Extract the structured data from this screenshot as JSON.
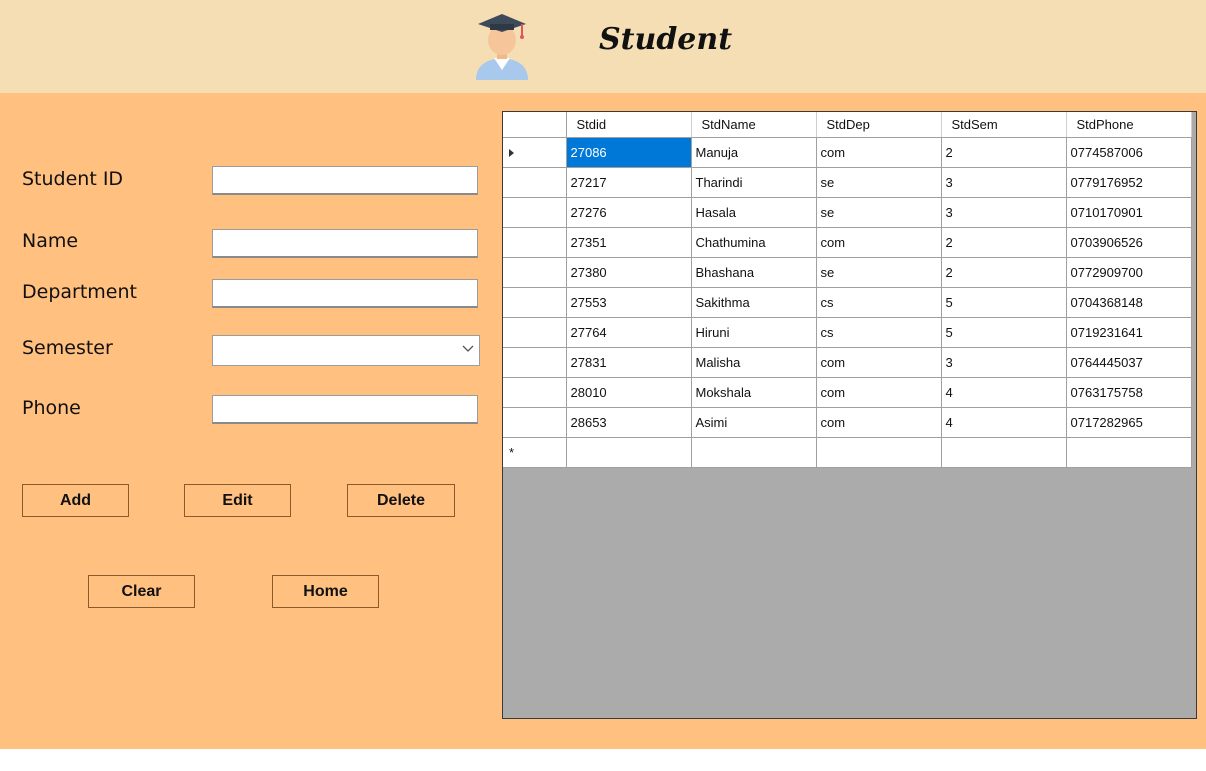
{
  "header": {
    "title": "Student",
    "icon": "graduate-avatar-icon"
  },
  "form": {
    "student_id_label": "Student ID",
    "student_id_value": "",
    "name_label": "Name",
    "name_value": "",
    "department_label": "Department",
    "department_value": "",
    "semester_label": "Semester",
    "semester_value": "",
    "phone_label": "Phone",
    "phone_value": ""
  },
  "buttons": {
    "add": "Add",
    "edit": "Edit",
    "delete": "Delete",
    "clear": "Clear",
    "home": "Home"
  },
  "grid": {
    "columns": [
      "Stdid",
      "StdName",
      "StdDep",
      "StdSem",
      "StdPhone"
    ],
    "rows": [
      [
        "27086",
        "Manuja",
        "com",
        "2",
        "0774587006"
      ],
      [
        "27217",
        "Tharindi",
        "se",
        "3",
        "0779176952"
      ],
      [
        "27276",
        "Hasala",
        "se",
        "3",
        "0710170901"
      ],
      [
        "27351",
        "Chathumina",
        "com",
        "2",
        "0703906526"
      ],
      [
        "27380",
        "Bhashana",
        "se",
        "2",
        "0772909700"
      ],
      [
        "27553",
        "Sakithma",
        "cs",
        "5",
        "0704368148"
      ],
      [
        "27764",
        "Hiruni",
        "cs",
        "5",
        "0719231641"
      ],
      [
        "27831",
        "Malisha",
        "com",
        "3",
        "0764445037"
      ],
      [
        "28010",
        "Mokshala",
        "com",
        "4",
        "0763175758"
      ],
      [
        "28653",
        "Asimi",
        "com",
        "4",
        "0717282965"
      ]
    ],
    "new_row_marker": "*",
    "selected_row": 0,
    "selected_color": "#0078d7"
  },
  "colors": {
    "header_bg": "#f5deb3",
    "form_bg": "#ffc080",
    "grid_empty_bg": "#ababab"
  }
}
